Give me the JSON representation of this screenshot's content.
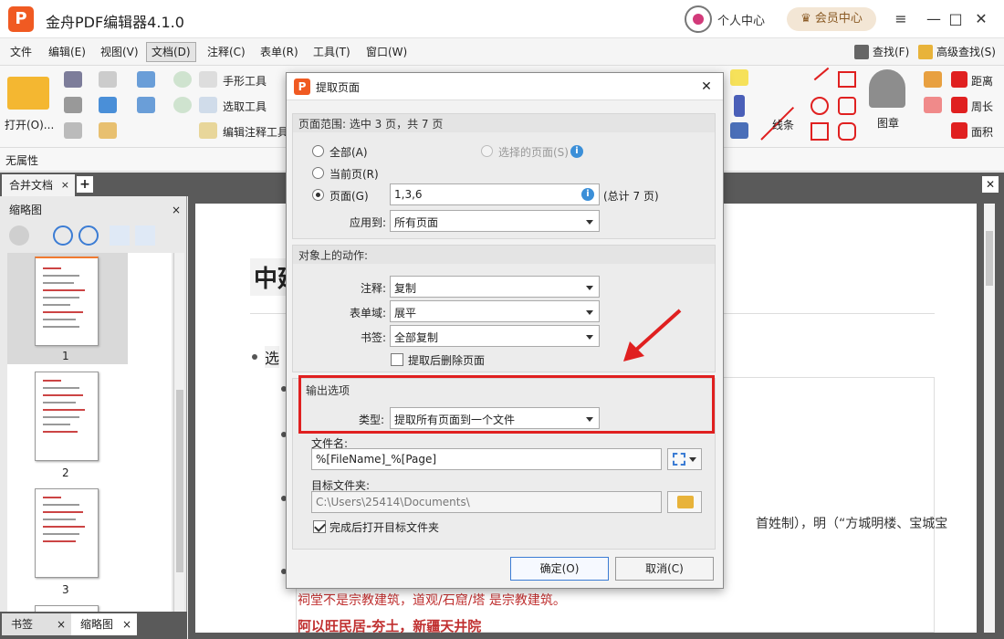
{
  "app": {
    "logo": "P",
    "title": "金舟PDF编辑器4.1.0",
    "personal_center": "个人中心",
    "vip_center": "会员中心",
    "menu_icon": "≡",
    "minimize": "—",
    "maximize": "□",
    "close": "✕"
  },
  "menu": {
    "items": [
      "文件",
      "编辑(E)",
      "视图(V)",
      "文档(D)",
      "注释(C)",
      "表单(R)",
      "工具(T)",
      "窗口(W)"
    ],
    "search": "查找(F)",
    "advanced_search": "高级查找(S)"
  },
  "toolbar": {
    "open": "打开(O)...",
    "hand_tool": "手形工具",
    "select_tool": "选取工具",
    "edit_annot_tool": "编辑注释工具",
    "lines": "线条",
    "stamp": "图章",
    "distance": "距离",
    "perimeter": "周长",
    "area": "面积",
    "no_props": "无属性"
  },
  "tabs": {
    "doc_tab": "合并文档",
    "close": "×",
    "add": "+"
  },
  "side_panel": {
    "title": "缩略图",
    "close": "×",
    "pages": [
      "1",
      "2",
      "3"
    ],
    "bottom_tabs": [
      "书签",
      "缩略图"
    ]
  },
  "document": {
    "heading": "中延",
    "text_snip": "选",
    "grey_text": "首姓制），明（“方城明楼、宝城宝",
    "red_text_1": "祠堂不是宗教建筑，道观/石窟/塔 是宗教建筑。",
    "red_text_2": "阿以旺民居-夯土，新疆天井院"
  },
  "dialog": {
    "logo": "P",
    "title": "提取页面",
    "close": "✕",
    "range": {
      "header": "页面范围: 选中 3 页，共 7 页",
      "all": "全部(A)",
      "selected_pages": "选择的页面(S)",
      "current_page": "当前页(R)",
      "pages": "页面(G)",
      "pages_value": "1,3,6",
      "total": "(总计 7 页)",
      "apply_to_label": "应用到:",
      "apply_to_value": "所有页面"
    },
    "actions": {
      "header": "对象上的动作:",
      "annot_label": "注释:",
      "annot_value": "复制",
      "form_label": "表单域:",
      "form_value": "展平",
      "bookmark_label": "书签:",
      "bookmark_value": "全部复制",
      "delete_after": "提取后删除页面"
    },
    "output": {
      "header": "输出选项",
      "type_label": "类型:",
      "type_value": "提取所有页面到一个文件",
      "filename_label": "文件名:",
      "filename_value": "%[FileName]_%[Page]",
      "folder_label": "目标文件夹:",
      "folder_value": "C:\\Users\\25414\\Documents\\",
      "open_after": "完成后打开目标文件夹"
    },
    "ok": "确定(O)",
    "cancel": "取消(C)"
  },
  "colors": {
    "accent_red": "#e02020",
    "brand_orange": "#f05a22",
    "info_blue": "#3b8fd8"
  }
}
